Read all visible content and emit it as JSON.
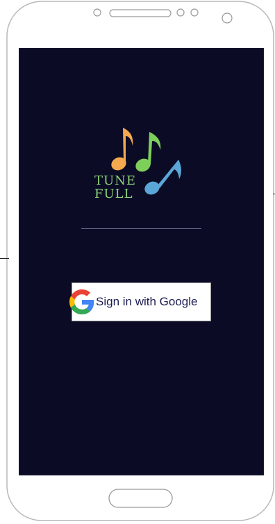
{
  "screen": {
    "background_color": "#0b0b26"
  },
  "logo": {
    "line1": "TUNE",
    "line2": "FULL",
    "colors": {
      "note_orange": "#f6a94e",
      "note_green": "#7ecf5a",
      "note_blue": "#5aa6d6",
      "text": "#8ed27a"
    }
  },
  "signin": {
    "label": "Sign in with Google"
  }
}
